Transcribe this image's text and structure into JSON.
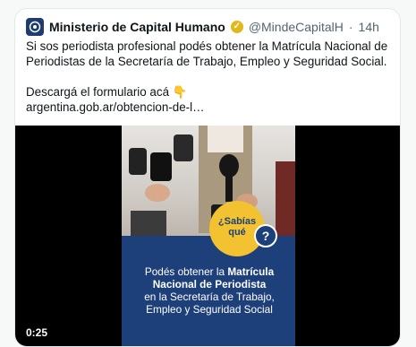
{
  "tweet": {
    "author_name": "Ministerio de Capital Humano",
    "handle": "@MindeCapitalH",
    "separator": "·",
    "time": "14h",
    "text_line1": "Si sos periodista profesional podés obtener la Matrícula Nacional de",
    "text_line2": "Periodistas de la Secretaría de Trabajo, Empleo y Seguridad Social.",
    "text_line3": "Descargá el formulario acá 👇",
    "link": "argentina.gob.ar/obtencion-de-l…"
  },
  "video": {
    "timestamp": "0:25",
    "bubble_line1": "¿Sabías",
    "bubble_line2": "qué",
    "question_mark": "?",
    "message_prefix": "Podés obtener la ",
    "message_bold1": "Matrícula",
    "message_bold2": "Nacional de Periodista",
    "message_line3": "en la Secretaría de Trabajo,",
    "message_line4": "Empleo y Seguridad Social"
  },
  "colors": {
    "panel_blue": "#1d3f7a",
    "bubble_yellow": "#f2c230",
    "verified_gold": "#e2b719"
  }
}
